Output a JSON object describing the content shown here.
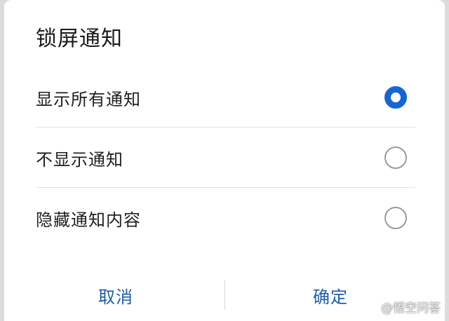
{
  "dialog": {
    "title": "锁屏通知",
    "options": [
      {
        "label": "显示所有通知",
        "selected": true
      },
      {
        "label": "不显示通知",
        "selected": false
      },
      {
        "label": "隐藏通知内容",
        "selected": false
      }
    ],
    "cancel_label": "取消",
    "confirm_label": "确定"
  },
  "watermark": {
    "text": "@悟空问答",
    "icon": "wukong-logo-icon"
  },
  "colors": {
    "accent": "#1565d8",
    "action_text": "#1d5ca8",
    "divider": "#e2e2e2",
    "radio_unchecked": "#9a9a9a"
  }
}
